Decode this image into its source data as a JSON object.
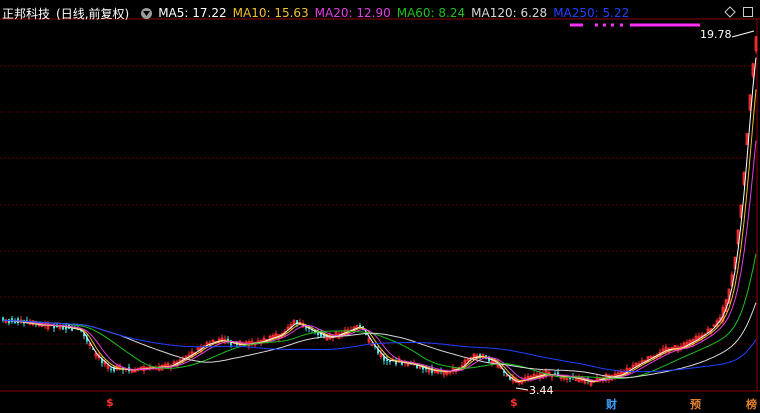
{
  "header": {
    "stock_name": "正邦科技",
    "period": "(日线,前复权)",
    "ma": [
      {
        "label": "MA5: 17.22",
        "color": "#ffffff"
      },
      {
        "label": "MA10: 15.63",
        "color": "#f0c030"
      },
      {
        "label": "MA20: 12.90",
        "color": "#e040e0"
      },
      {
        "label": "MA60: 8.24",
        "color": "#20c020"
      },
      {
        "label": "MA120: 6.28",
        "color": "#d8d8d8"
      },
      {
        "label": "MA250: 5.22",
        "color": "#2040ff"
      }
    ]
  },
  "controls": {
    "diamond": "diamond-icon",
    "maximize": "maximize-icon"
  },
  "annotations": {
    "high_price": "19.78",
    "low_price": "3.44"
  },
  "event_markers": [
    {
      "label": "$",
      "color": "#ff3030"
    },
    {
      "label": "$",
      "color": "#ff3030"
    },
    {
      "label": "财",
      "color": "#40a0ff"
    },
    {
      "label": "预",
      "color": "#e08030"
    },
    {
      "label": "榜",
      "color": "#e08030"
    }
  ],
  "colors": {
    "background": "#000000",
    "up": "#ff3030",
    "down": "#40e0e0",
    "grid": "#600000"
  }
}
